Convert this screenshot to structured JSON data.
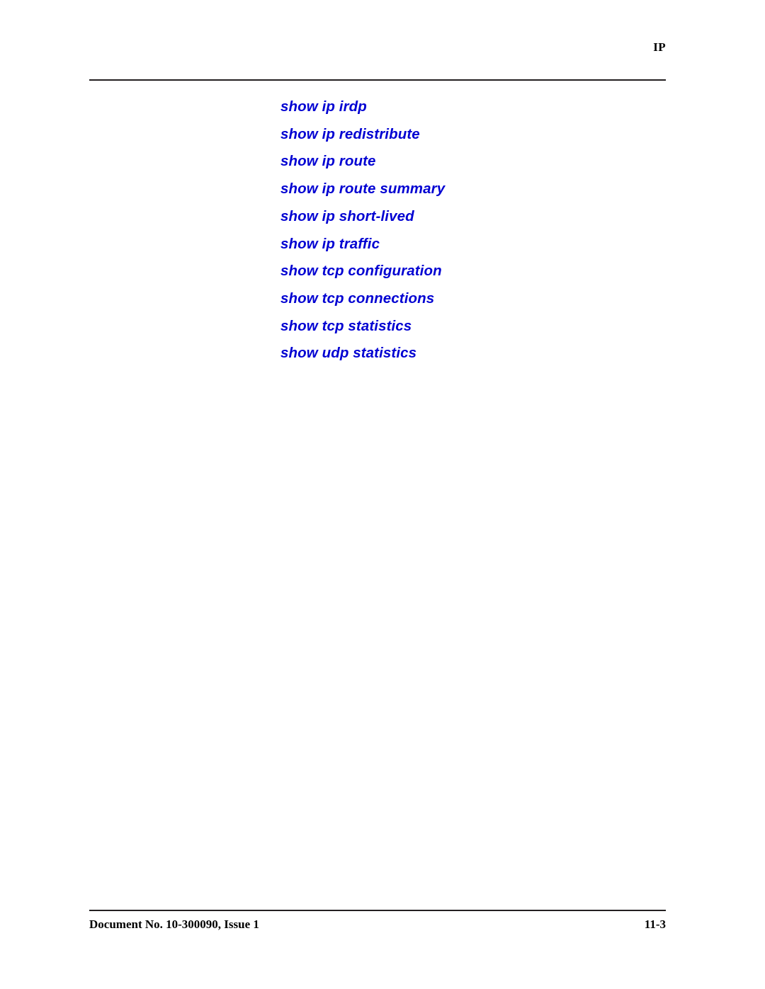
{
  "document": {
    "background_color": "#ffffff",
    "text_color": "#000000",
    "accent_color": "#0000d2"
  },
  "header": {
    "title": "IP"
  },
  "main": {
    "commands": [
      {
        "label": "show ip irdp"
      },
      {
        "label": "show ip redistribute"
      },
      {
        "label": "show ip route"
      },
      {
        "label": "show ip route summary"
      },
      {
        "label": "show ip short-lived"
      },
      {
        "label": "show ip traffic"
      },
      {
        "label": "show tcp configuration"
      },
      {
        "label": "show tcp connections"
      },
      {
        "label": "show tcp statistics"
      },
      {
        "label": "show udp statistics"
      }
    ]
  },
  "footer": {
    "document_number": "Document No. 10-300090, Issue 1",
    "page_number": "11-3"
  }
}
